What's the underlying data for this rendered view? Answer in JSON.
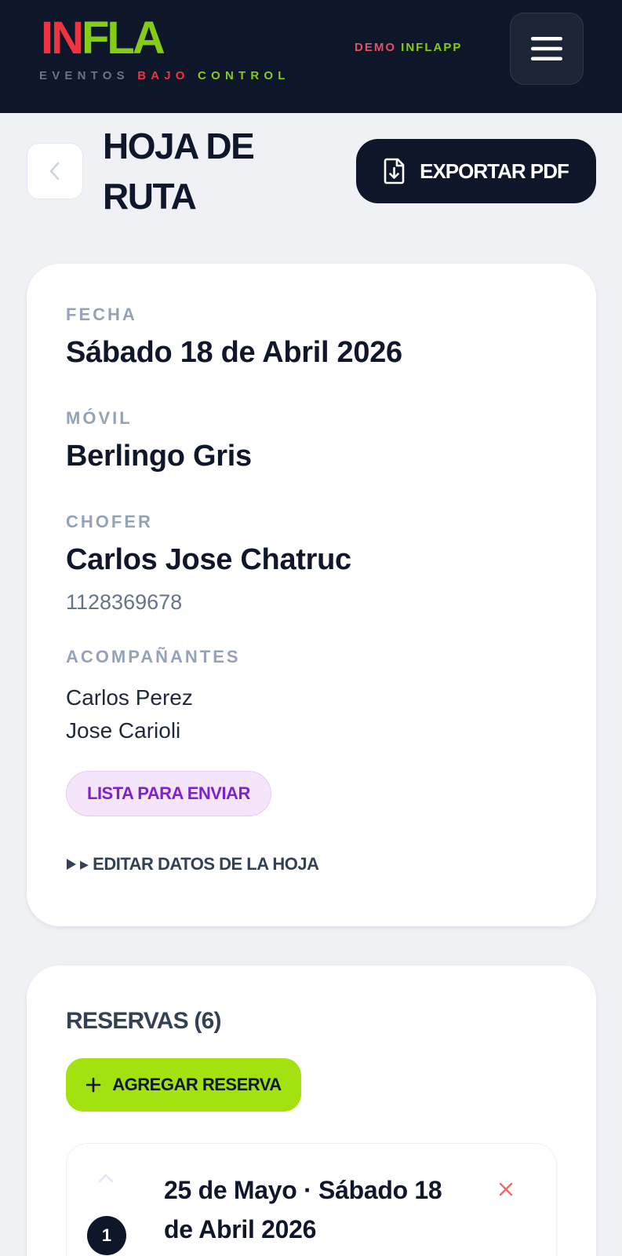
{
  "header": {
    "logo_part1": "IN",
    "logo_part2": "FLA",
    "tagline_part1": "EVENTOS",
    "tagline_part2": "BAJO",
    "tagline_part3": "CONTROL",
    "account_part1": "DEMO",
    "account_part2": "INFLAPP",
    "menu_icon": "hamburger-icon"
  },
  "page": {
    "title": "HOJA DE RUTA",
    "back_icon": "chevron-left-icon",
    "export_label": "EXPORTAR PDF",
    "export_icon": "file-download-icon"
  },
  "info": {
    "fecha_label": "FECHA",
    "fecha_value": "Sábado 18 de Abril 2026",
    "movil_label": "MÓVIL",
    "movil_value": "Berlingo Gris",
    "chofer_label": "CHOFER",
    "chofer_value": "Carlos Jose Chatruc",
    "chofer_phone": "1128369678",
    "acompanantes_label": "ACOMPAÑANTES",
    "acompanantes": [
      "Carlos Perez",
      "Jose Carioli"
    ],
    "status": "LISTA PARA ENVIAR",
    "edit_label": "▸ EDITAR DATOS DE LA HOJA"
  },
  "reservas": {
    "title": "RESERVAS (6)",
    "add_label": "AGREGAR RESERVA",
    "items": [
      {
        "number": "1",
        "title": "25 de Mayo · Sábado 18 de Abril 2026"
      }
    ]
  },
  "colors": {
    "header_bg": "#0e1629",
    "brand_red": "#ef3340",
    "brand_green": "#84cc16",
    "add_button": "#a3e20f",
    "status_purple": "#7e22ce"
  }
}
